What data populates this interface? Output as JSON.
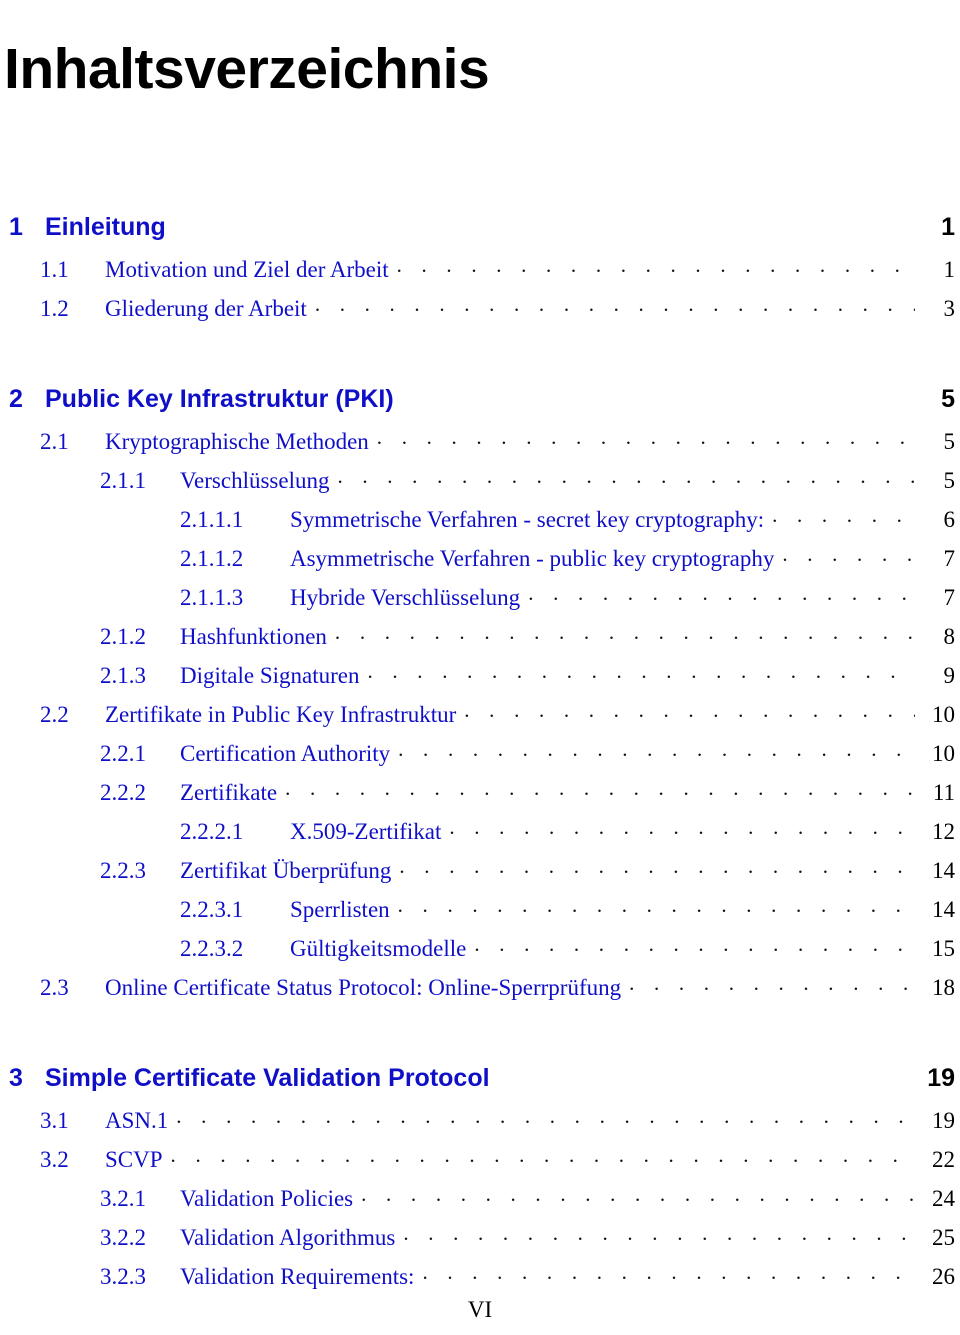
{
  "document": {
    "title": "Inhaltsverzeichnis",
    "footer_page_number": "VI",
    "colors": {
      "entry_blue": "#0f0fc8",
      "page_number_black": "#000000",
      "title_black": "#000000",
      "leader_dots": "#111111",
      "background": "#ffffff"
    }
  },
  "toc": {
    "entries": [
      {
        "level": 1,
        "number": "1",
        "label": "Einleitung",
        "page": "1"
      },
      {
        "level": 2,
        "number": "1.1",
        "label": "Motivation und Ziel der Arbeit",
        "page": "1"
      },
      {
        "level": 2,
        "number": "1.2",
        "label": "Gliederung der Arbeit",
        "page": "3"
      },
      {
        "level": 1,
        "number": "2",
        "label": "Public Key Infrastruktur (PKI)",
        "page": "5"
      },
      {
        "level": 2,
        "number": "2.1",
        "label": "Kryptographische Methoden",
        "page": "5"
      },
      {
        "level": 3,
        "number": "2.1.1",
        "label": "Verschlüsselung",
        "page": "5"
      },
      {
        "level": 4,
        "number": "2.1.1.1",
        "label": "Symmetrische Verfahren - secret key cryptography:",
        "page": "6"
      },
      {
        "level": 4,
        "number": "2.1.1.2",
        "label": "Asymmetrische Verfahren - public key cryptography",
        "page": "7"
      },
      {
        "level": 4,
        "number": "2.1.1.3",
        "label": "Hybride Verschlüsselung",
        "page": "7"
      },
      {
        "level": 3,
        "number": "2.1.2",
        "label": "Hashfunktionen",
        "page": "8"
      },
      {
        "level": 3,
        "number": "2.1.3",
        "label": "Digitale Signaturen",
        "page": "9"
      },
      {
        "level": 2,
        "number": "2.2",
        "label": "Zertifikate in Public Key Infrastruktur",
        "page": "10"
      },
      {
        "level": 3,
        "number": "2.2.1",
        "label": "Certification Authority",
        "page": "10"
      },
      {
        "level": 3,
        "number": "2.2.2",
        "label": "Zertifikate",
        "page": "11"
      },
      {
        "level": 4,
        "number": "2.2.2.1",
        "label": "X.509-Zertifikat",
        "page": "12"
      },
      {
        "level": 3,
        "number": "2.2.3",
        "label": "Zertifikat Überprüfung",
        "page": "14"
      },
      {
        "level": 4,
        "number": "2.2.3.1",
        "label": "Sperrlisten",
        "page": "14"
      },
      {
        "level": 4,
        "number": "2.2.3.2",
        "label": "Gültigkeitsmodelle",
        "page": "15"
      },
      {
        "level": 2,
        "number": "2.3",
        "label": "Online Certificate Status Protocol: Online-Sperrprüfung",
        "page": "18"
      },
      {
        "level": 1,
        "number": "3",
        "label": "Simple Certificate Validation Protocol",
        "page": "19"
      },
      {
        "level": 2,
        "number": "3.1",
        "label": "ASN.1",
        "page": "19"
      },
      {
        "level": 2,
        "number": "3.2",
        "label": "SCVP",
        "page": "22"
      },
      {
        "level": 3,
        "number": "3.2.1",
        "label": "Validation Policies",
        "page": "24"
      },
      {
        "level": 3,
        "number": "3.2.2",
        "label": "Validation Algorithmus",
        "page": "25"
      },
      {
        "level": 3,
        "number": "3.2.3",
        "label": "Validation Requirements:",
        "page": "26"
      }
    ]
  }
}
